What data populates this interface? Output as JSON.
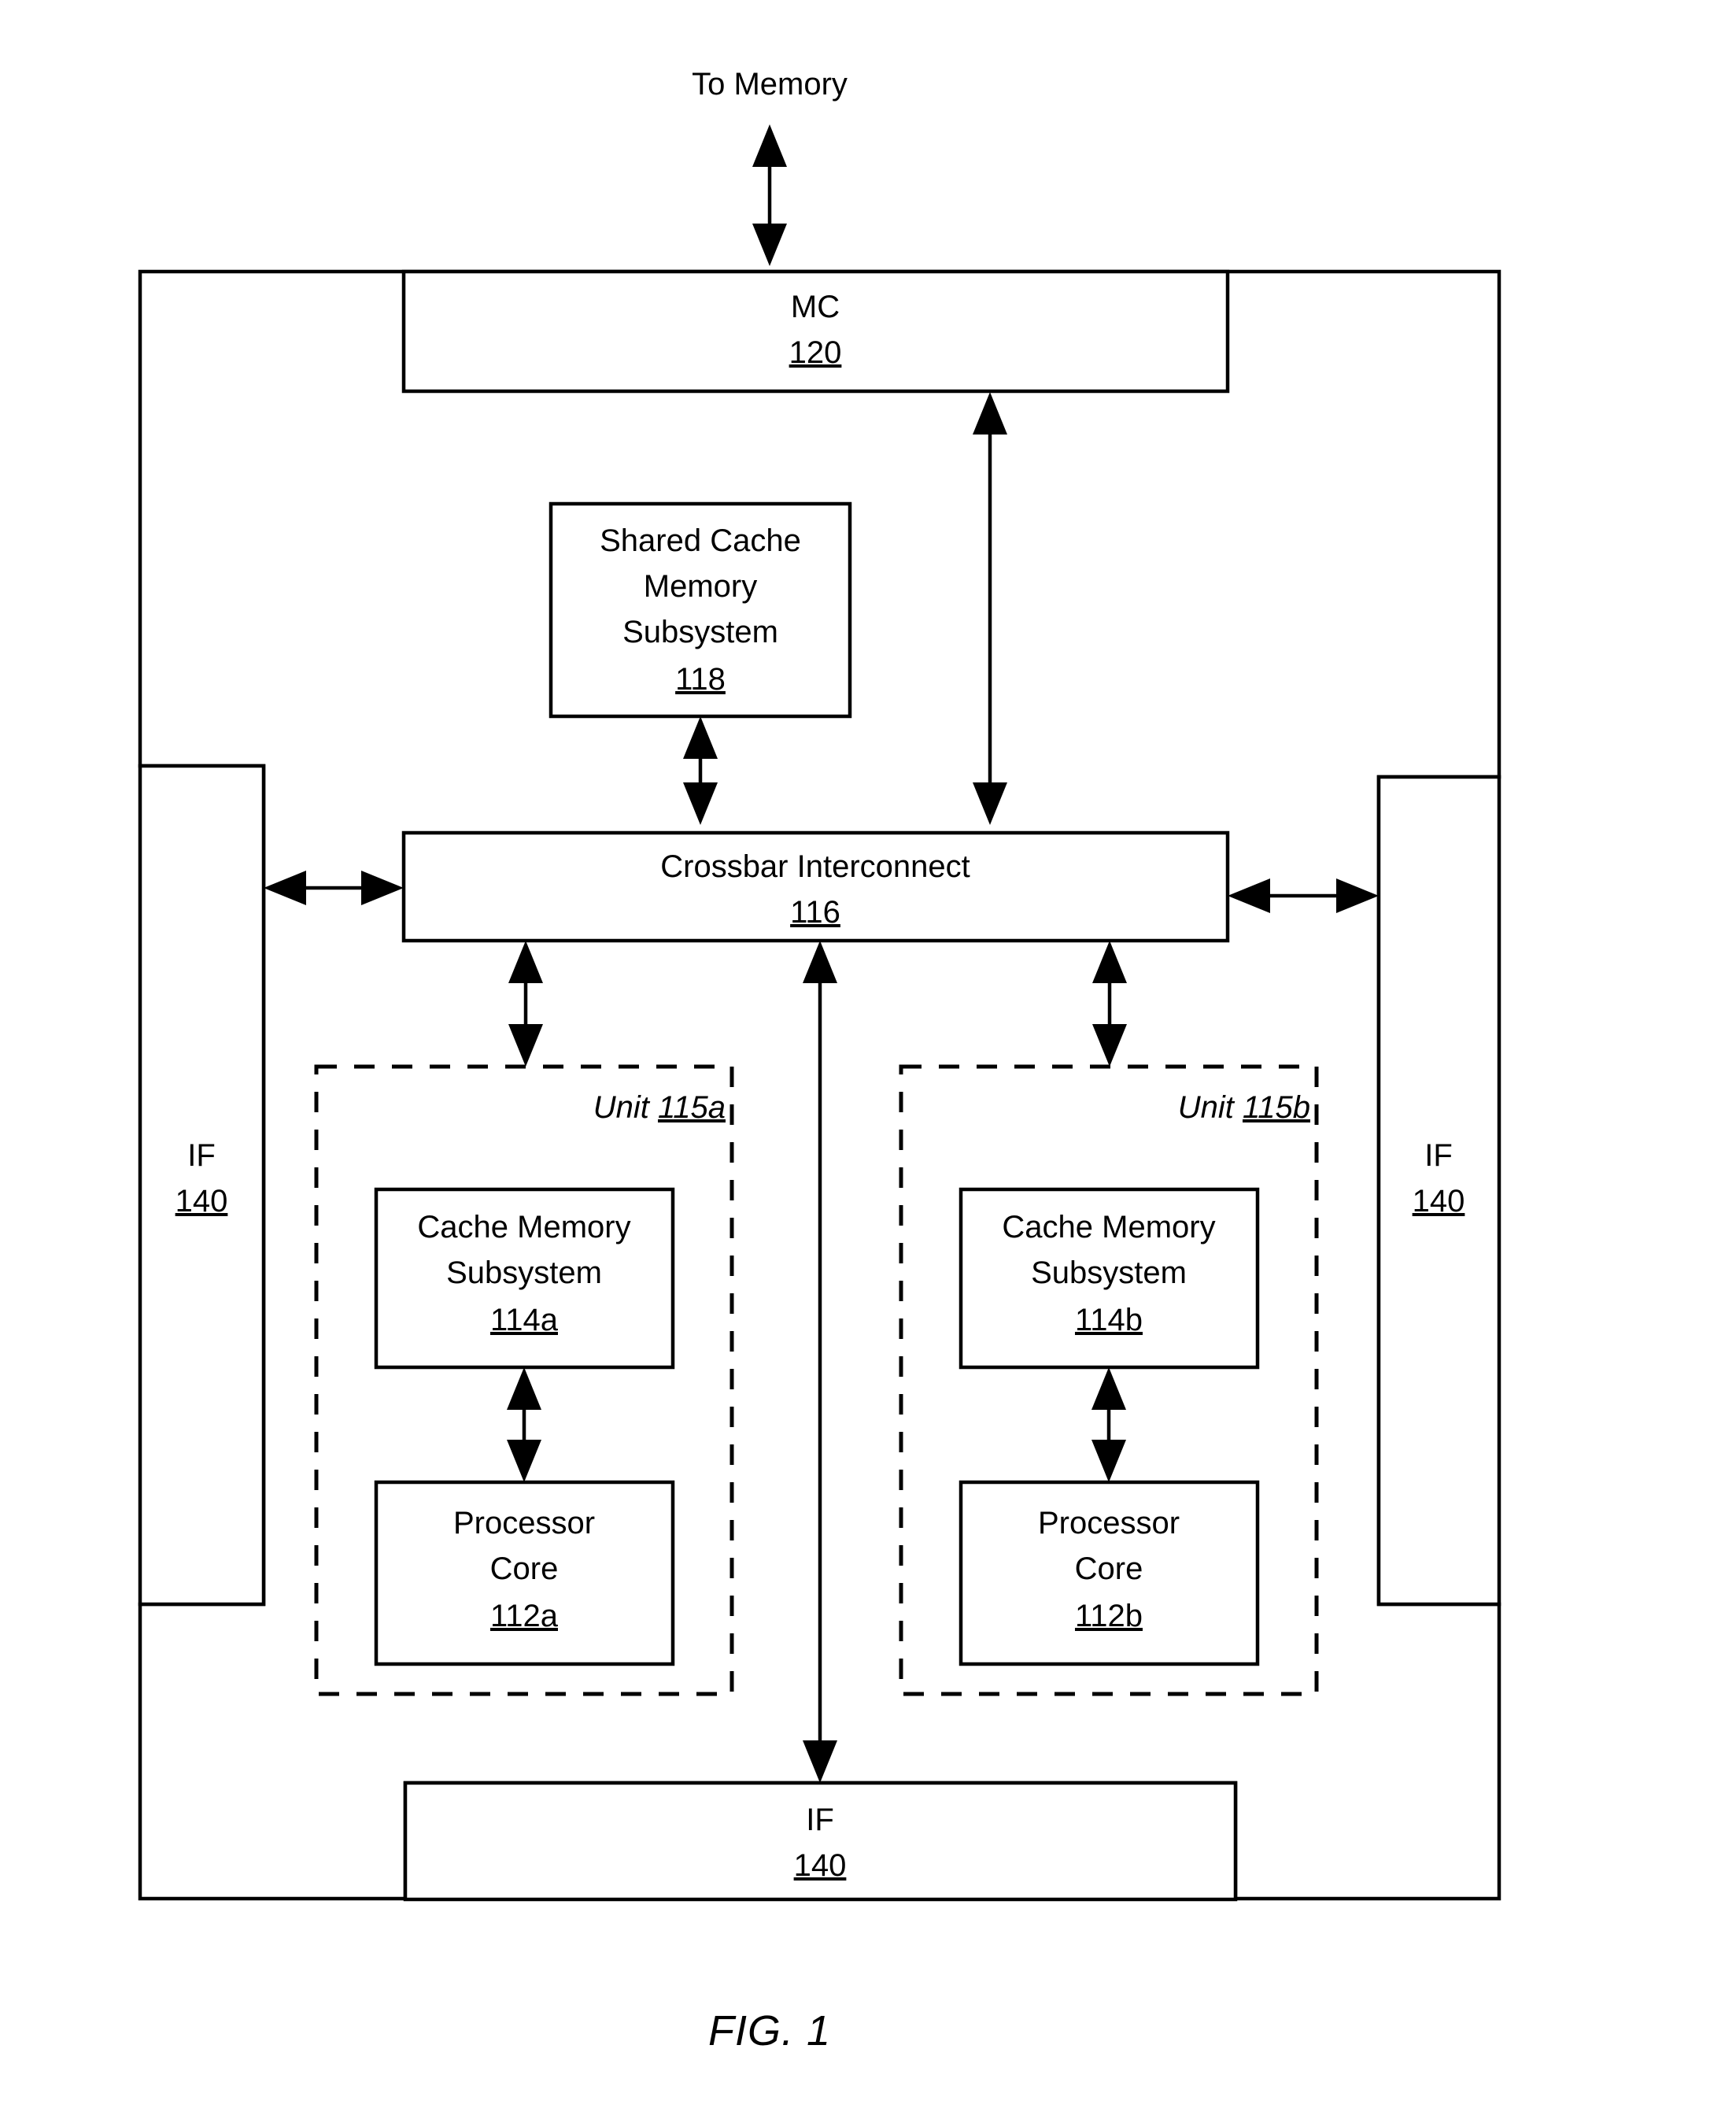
{
  "figure": {
    "caption": "FIG. 1",
    "top_label": "To Memory"
  },
  "blocks": {
    "mc": {
      "title": "MC",
      "ref": "120"
    },
    "shared_cache": {
      "line1": "Shared Cache",
      "line2": "Memory",
      "line3": "Subsystem",
      "ref": "118"
    },
    "crossbar": {
      "title": "Crossbar Interconnect",
      "ref": "116"
    },
    "if_left": {
      "title": "IF",
      "ref": "140"
    },
    "if_right": {
      "title": "IF",
      "ref": "140"
    },
    "if_bottom": {
      "title": "IF",
      "ref": "140"
    },
    "unit_a": {
      "label_word": "Unit",
      "label_ref": "115a",
      "cache": {
        "line1": "Cache Memory",
        "line2": "Subsystem",
        "ref": "114a"
      },
      "core": {
        "line1": "Processor",
        "line2": "Core",
        "ref": "112a"
      }
    },
    "unit_b": {
      "label_word": "Unit",
      "label_ref": "115b",
      "cache": {
        "line1": "Cache Memory",
        "line2": "Subsystem",
        "ref": "114b"
      },
      "core": {
        "line1": "Processor",
        "line2": "Core",
        "ref": "112b"
      }
    }
  },
  "colors": {
    "stroke": "#000000",
    "background": "#ffffff"
  }
}
